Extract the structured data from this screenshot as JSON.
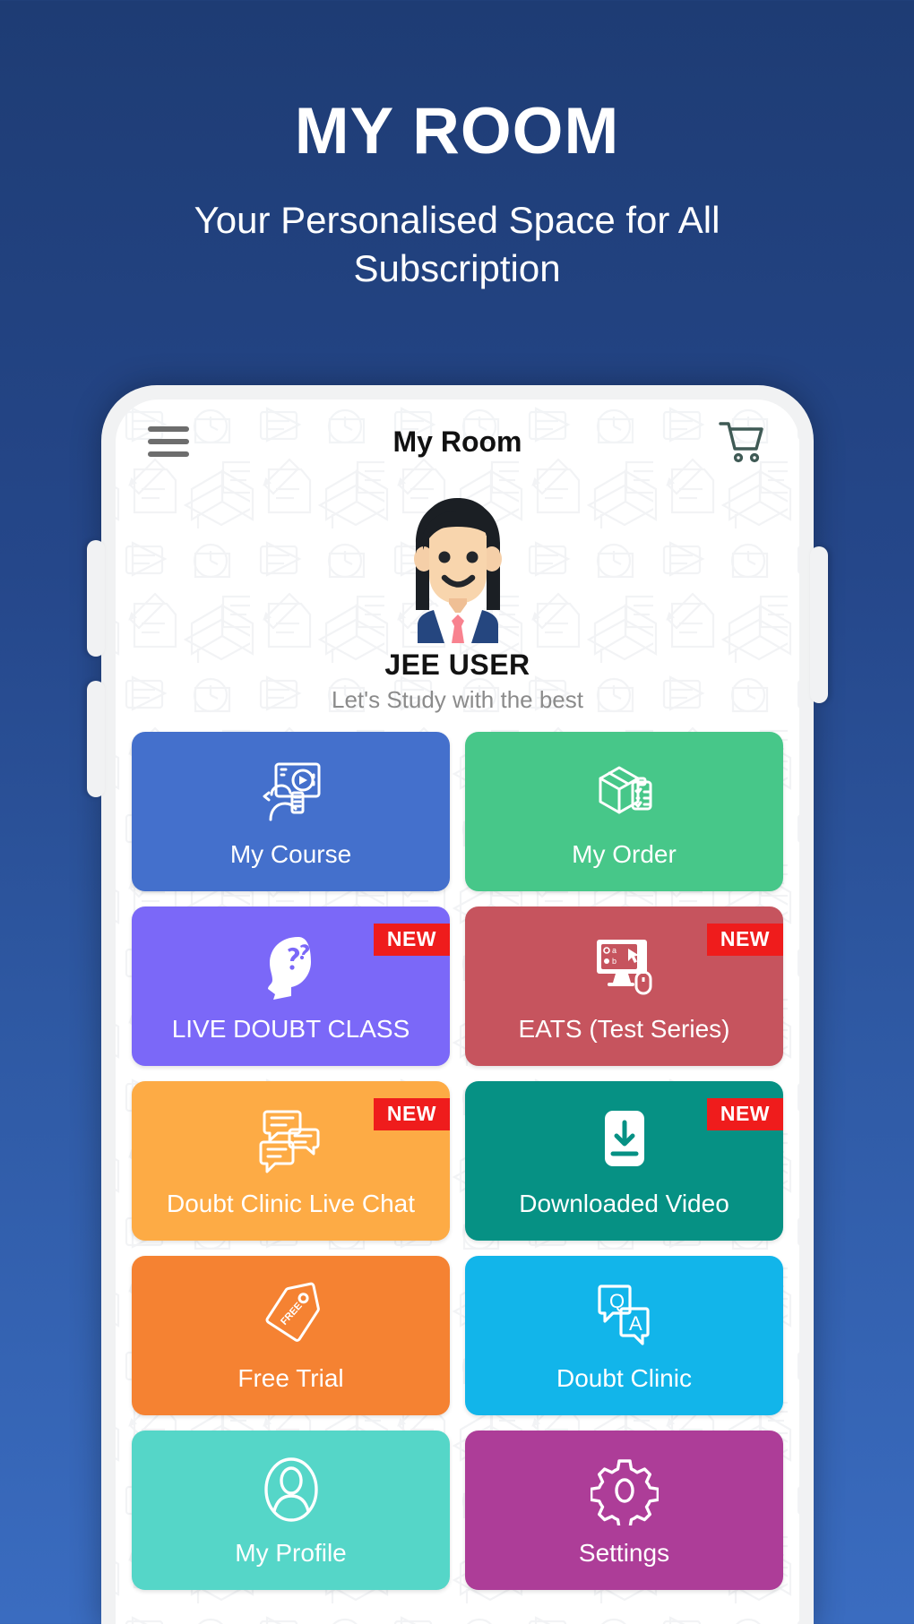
{
  "promo": {
    "title": "MY ROOM",
    "subtitle": "Your Personalised Space for All Subscription"
  },
  "colors": {
    "bg_top": "#1e3c74",
    "bg_bottom": "#3a6cc0",
    "badge": "#ef1c1c"
  },
  "appbar": {
    "menu_icon": "hamburger-menu-icon",
    "title": "My Room",
    "cart_icon": "shopping-cart-icon"
  },
  "profile": {
    "avatar_icon": "user-avatar-female-student",
    "name": "JEE USER",
    "tagline": "Let's Study with the best"
  },
  "tiles": [
    {
      "label": "My Course",
      "color": "#4470cc",
      "icon": "video-lesson-icon",
      "badge": ""
    },
    {
      "label": "My Order",
      "color": "#47c789",
      "icon": "package-checklist-icon",
      "badge": ""
    },
    {
      "label": "LIVE DOUBT CLASS",
      "color": "#7b68f8",
      "icon": "head-question-icon",
      "badge": "NEW"
    },
    {
      "label": "EATS (Test Series)",
      "color": "#c6545e",
      "icon": "monitor-mouse-icon",
      "badge": "NEW"
    },
    {
      "label": "Doubt Clinic Live Chat",
      "color": "#fdab45",
      "icon": "chat-bubbles-icon",
      "badge": "NEW"
    },
    {
      "label": "Downloaded Video",
      "color": "#069184",
      "icon": "download-file-icon",
      "badge": "NEW"
    },
    {
      "label": "Free Trial",
      "color": "#f58232",
      "icon": "free-tag-icon",
      "badge": ""
    },
    {
      "label": "Doubt Clinic",
      "color": "#12b5ea",
      "icon": "qa-bubbles-icon",
      "badge": ""
    },
    {
      "label": "My Profile",
      "color": "#55d6c8",
      "icon": "person-outline-icon",
      "badge": ""
    },
    {
      "label": "Settings",
      "color": "#ad3d98",
      "icon": "gear-icon",
      "badge": ""
    }
  ]
}
